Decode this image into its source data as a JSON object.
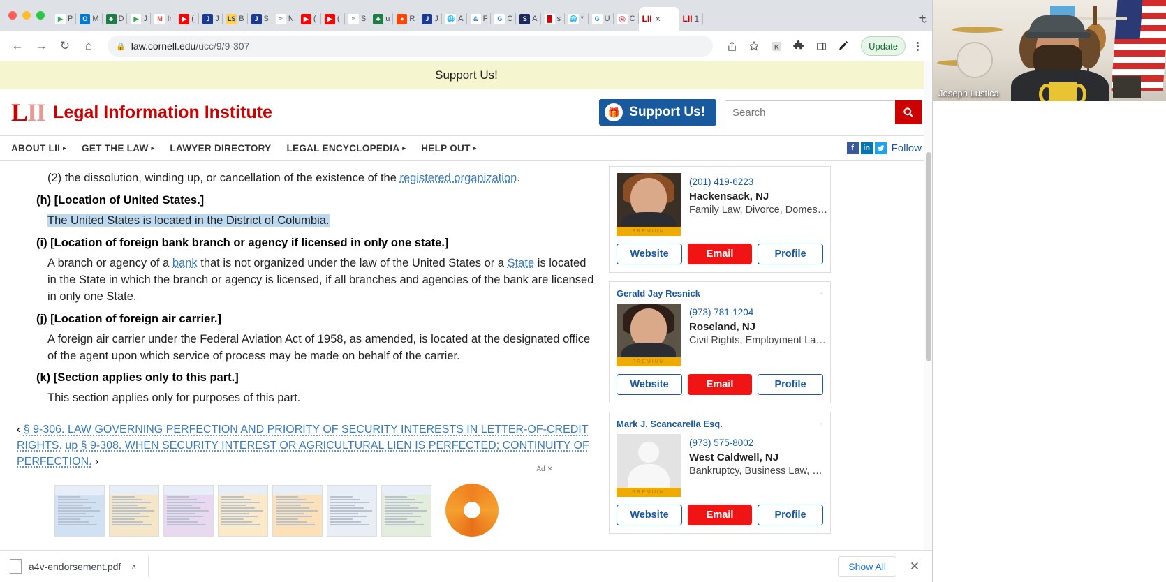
{
  "browser": {
    "window_buttons": [
      "close",
      "minimize",
      "maximize"
    ],
    "tabs": [
      {
        "label": "P",
        "favicon": "play-green",
        "active": false
      },
      {
        "label": "M",
        "favicon": "outlook-blue",
        "active": false
      },
      {
        "label": "D",
        "favicon": "money-green",
        "active": false
      },
      {
        "label": "J",
        "favicon": "play-green",
        "active": false
      },
      {
        "label": "Ir",
        "favicon": "gmail",
        "active": false
      },
      {
        "label": "(",
        "favicon": "youtube-red",
        "active": false
      },
      {
        "label": "J",
        "favicon": "jira-blue",
        "active": false
      },
      {
        "label": "B",
        "favicon": "ls-yellow",
        "active": false
      },
      {
        "label": "S",
        "favicon": "jira-blue",
        "active": false
      },
      {
        "label": "N",
        "favicon": "wave-gray",
        "active": false
      },
      {
        "label": "(",
        "favicon": "youtube-red",
        "active": false
      },
      {
        "label": "(",
        "favicon": "youtube-red",
        "active": false
      },
      {
        "label": "S",
        "favicon": "wave-gray",
        "active": false
      },
      {
        "label": "u",
        "favicon": "money-green",
        "active": false
      },
      {
        "label": "R",
        "favicon": "reddit-orange",
        "active": false
      },
      {
        "label": "J",
        "favicon": "jira-blue",
        "active": false
      },
      {
        "label": "A",
        "favicon": "globe-gray",
        "active": false
      },
      {
        "label": "F",
        "favicon": "ampersand-blue",
        "active": false
      },
      {
        "label": "C",
        "favicon": "google-g",
        "active": false
      },
      {
        "label": "A",
        "favicon": "ssa-navy",
        "active": false
      },
      {
        "label": "s",
        "favicon": "bars-red",
        "active": false
      },
      {
        "label": "*",
        "favicon": "globe-gray",
        "active": false
      },
      {
        "label": "U",
        "favicon": "google-g",
        "active": false
      },
      {
        "label": "C",
        "favicon": "mw-circle",
        "active": false
      },
      {
        "label": "LII",
        "favicon": "lii",
        "active": true,
        "close": "✕"
      },
      {
        "label": "LII",
        "favicon": "lii",
        "active": false,
        "suffix": "1"
      }
    ],
    "new_tab_label": "+",
    "tab_list_chevron": "⌄",
    "nav": {
      "back": "←",
      "forward": "→",
      "reload": "↻",
      "home": "⌂"
    },
    "omnibox": {
      "lock_icon": "🔒",
      "url_domain": "law.cornell.edu",
      "url_path": "/ucc/9/9-307"
    },
    "toolbar_icons": [
      "share-icon",
      "bookmark-star-icon",
      "k-extension-icon",
      "puzzle-extensions-icon",
      "sidebar-panel-icon",
      "pen-icon"
    ],
    "update_button": "Update",
    "menu_icon": "three-dots-vertical"
  },
  "site": {
    "support_banner": "Support Us!",
    "logo_mark": "LII",
    "logo_text": "Legal Information Institute",
    "support_button": "Support Us!",
    "search_placeholder": "Search",
    "search_value": "",
    "nav_items": [
      {
        "label": "ABOUT LII",
        "has_caret": true
      },
      {
        "label": "GET THE LAW",
        "has_caret": true
      },
      {
        "label": "LAWYER DIRECTORY",
        "has_caret": false
      },
      {
        "label": "LEGAL ENCYCLOPEDIA",
        "has_caret": true
      },
      {
        "label": "HELP OUT",
        "has_caret": true
      }
    ],
    "social": {
      "facebook": "f",
      "linkedin": "in",
      "twitter": "✓",
      "follow_label": "Follow"
    }
  },
  "document": {
    "paragraph_2_prefix": "(2) the dissolution, winding up, or cancellation of the existence of the ",
    "paragraph_2_link": "registered organization",
    "paragraph_2_suffix": ".",
    "heading_h": "(h) [Location of United States.]",
    "highlighted_text": "The United States is located in the District of Columbia.",
    "heading_i": "(i) [Location of foreign bank branch or agency if licensed in only one state.]",
    "para_i_part1": "A branch or agency of a ",
    "para_i_link1": "bank",
    "para_i_part2": " that is not organized under the law of the United States or a ",
    "para_i_link2": "State",
    "para_i_part3": " is located in the State in which the branch or agency is licensed, if all branches and agencies of the bank are licensed in only one State.",
    "heading_j": "(j) [Location of foreign air carrier.]",
    "para_j": "A foreign air carrier under the Federal Aviation Act of 1958, as amended, is located at the designated office of the agent upon which service of process may be made on behalf of the carrier.",
    "heading_k": "(k) [Section applies only to this part.]",
    "para_k": "This section applies only for purposes of this part.",
    "prev_arrow": "‹",
    "prev_link": "§ 9-306. LAW GOVERNING PERFECTION AND PRIORITY OF SECURITY INTERESTS IN LETTER-OF-CREDIT RIGHTS.",
    "up_label": "up",
    "next_link": "§ 9-308. WHEN SECURITY INTEREST OR AGRICULTURAL LIEN IS PERFECTED; CONTINUITY OF PERFECTION.",
    "next_arrow": "›"
  },
  "ad": {
    "label": "Ad",
    "close": "✕",
    "thumbnail_count": 7
  },
  "lawyers": [
    {
      "name": "",
      "phone": "(201) 419-6223",
      "city": "Hackensack, NJ",
      "specialties": "Family Law, Divorce, Domesti...",
      "badge": "PREMIUM",
      "avatar": "photo-female",
      "buttons": {
        "website": "Website",
        "email": "Email",
        "profile": "Profile"
      }
    },
    {
      "name": "Gerald Jay Resnick",
      "phone": "(973) 781-1204",
      "city": "Roseland, NJ",
      "specialties": "Civil Rights, Employment Law,...",
      "badge": "PREMIUM",
      "avatar": "photo-male",
      "buttons": {
        "website": "Website",
        "email": "Email",
        "profile": "Profile"
      }
    },
    {
      "name": "Mark J. Scancarella Esq.",
      "phone": "(973) 575-8002",
      "city": "West Caldwell, NJ",
      "specialties": "Bankruptcy, Business Law, Es...",
      "badge": "PREMIUM",
      "avatar": "placeholder",
      "buttons": {
        "website": "Website",
        "email": "Email",
        "profile": "Profile"
      }
    }
  ],
  "downloads": {
    "file_name": "a4v-endorsement.pdf",
    "chevron": "∧",
    "show_all": "Show All",
    "close": "✕"
  },
  "webcam": {
    "participant_name": "Joseph Lustica"
  },
  "colors": {
    "lii_red": "#cc0000",
    "support_blue": "#19599e",
    "email_red": "#f01414",
    "banner_yellow": "#f5f5cf",
    "highlight_blue": "#bcd9f2",
    "link_blue": "#3a7bb8",
    "update_green": "#137333"
  }
}
